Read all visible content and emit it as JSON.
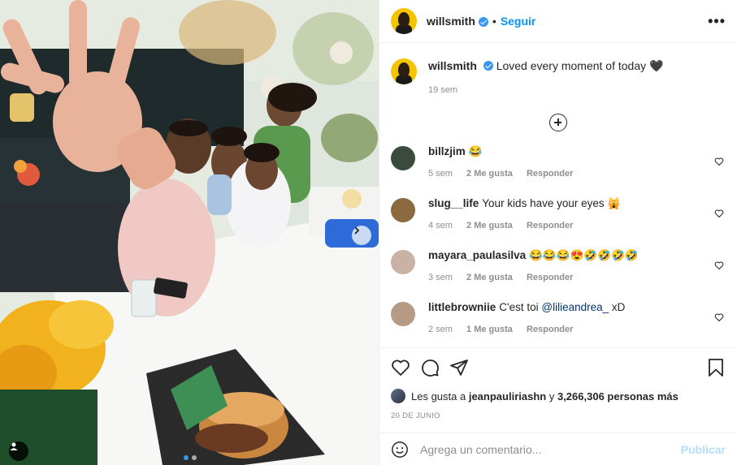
{
  "post": {
    "username": "willsmith",
    "follow_label": "Seguir",
    "more_label": "•••",
    "caption": "Loved every moment of today 🖤",
    "caption_time": "19 sem"
  },
  "comments": [
    {
      "user": "billzjim",
      "text": "😂",
      "time": "5 sem",
      "likes": "2 Me gusta",
      "reply": "Responder",
      "avatar_color": "#3a4a3c"
    },
    {
      "user": "slug__life",
      "text": "Your kids have your eyes 🙀",
      "time": "4 sem",
      "likes": "2 Me gusta",
      "reply": "Responder",
      "avatar_color": "#8a6a3e"
    },
    {
      "user": "mayara_paulasilva",
      "text": "😂😂😂😍🤣🤣🤣🤣",
      "time": "3 sem",
      "likes": "2 Me gusta",
      "reply": "Responder",
      "avatar_color": "#c9b1a3"
    },
    {
      "user": "littlebrowniie",
      "text": "C'est toi ",
      "mention": "@lilieandrea_",
      "text_after": " xD",
      "time": "2 sem",
      "likes": "1 Me gusta",
      "reply": "Responder",
      "avatar_color": "#b79a86"
    }
  ],
  "likes": {
    "prefix": "Les gusta a",
    "user": "jeanpauliriashn",
    "connector": "y",
    "count": "3,266,306 personas más"
  },
  "date": "20 DE JUNIO",
  "add_comment": {
    "placeholder": "Agrega un comentario...",
    "publish_label": "Publicar"
  },
  "carousel": {
    "current": 1,
    "total": 2
  },
  "icons": [
    "heart-icon",
    "comment-icon",
    "share-icon",
    "bookmark-icon",
    "emoji-icon",
    "plus-circle-icon",
    "more-icon",
    "verified-icon",
    "user-tag-icon",
    "chevron-right-icon"
  ],
  "colors": {
    "link": "#0095f6",
    "verified": "#3897f0",
    "muted": "#8e8e8e",
    "publish_disabled": "#b2dffc",
    "avatar_bg": "#f5c400"
  }
}
